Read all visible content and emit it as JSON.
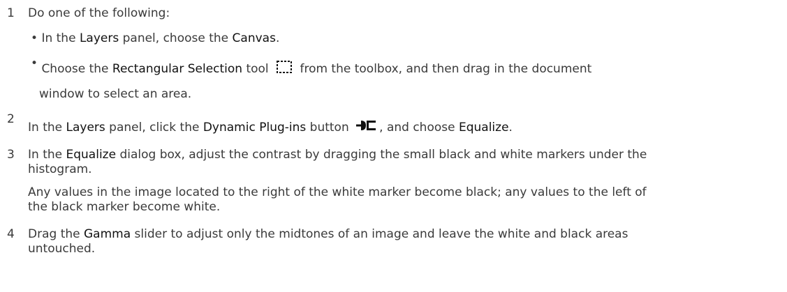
{
  "steps": [
    {
      "number": "1",
      "text": "Do one of the following:",
      "bullets": [
        {
          "marker": "•",
          "parts": [
            "In the ",
            "Layers",
            " panel, choose the ",
            "Canvas",
            "."
          ]
        },
        {
          "marker": "•",
          "parts": [
            "Choose the ",
            "Rectangular Selection",
            " tool ",
            " from the toolbox, and then drag in the document"
          ],
          "icon": "rectangular-selection-tool-icon",
          "continuation": "window to select an area."
        }
      ]
    },
    {
      "number": "2",
      "parts": [
        "In the ",
        "Layers",
        " panel, click the ",
        "Dynamic Plug-ins",
        " button ",
        ", and choose ",
        "Equalize",
        "."
      ],
      "icon": "dynamic-plug-ins-icon"
    },
    {
      "number": "3",
      "parts": [
        "In the ",
        "Equalize",
        " dialog box, adjust the contrast by dragging the small black and white markers under the"
      ],
      "line2": "histogram.",
      "note1": "Any values in the image located to the right of the white marker become black; any values to the left of",
      "note2": "the black marker become white."
    },
    {
      "number": "4",
      "parts": [
        "Drag the ",
        "Gamma",
        " slider to adjust only the midtones of an image and leave the white and black areas"
      ],
      "line2": "untouched."
    }
  ]
}
